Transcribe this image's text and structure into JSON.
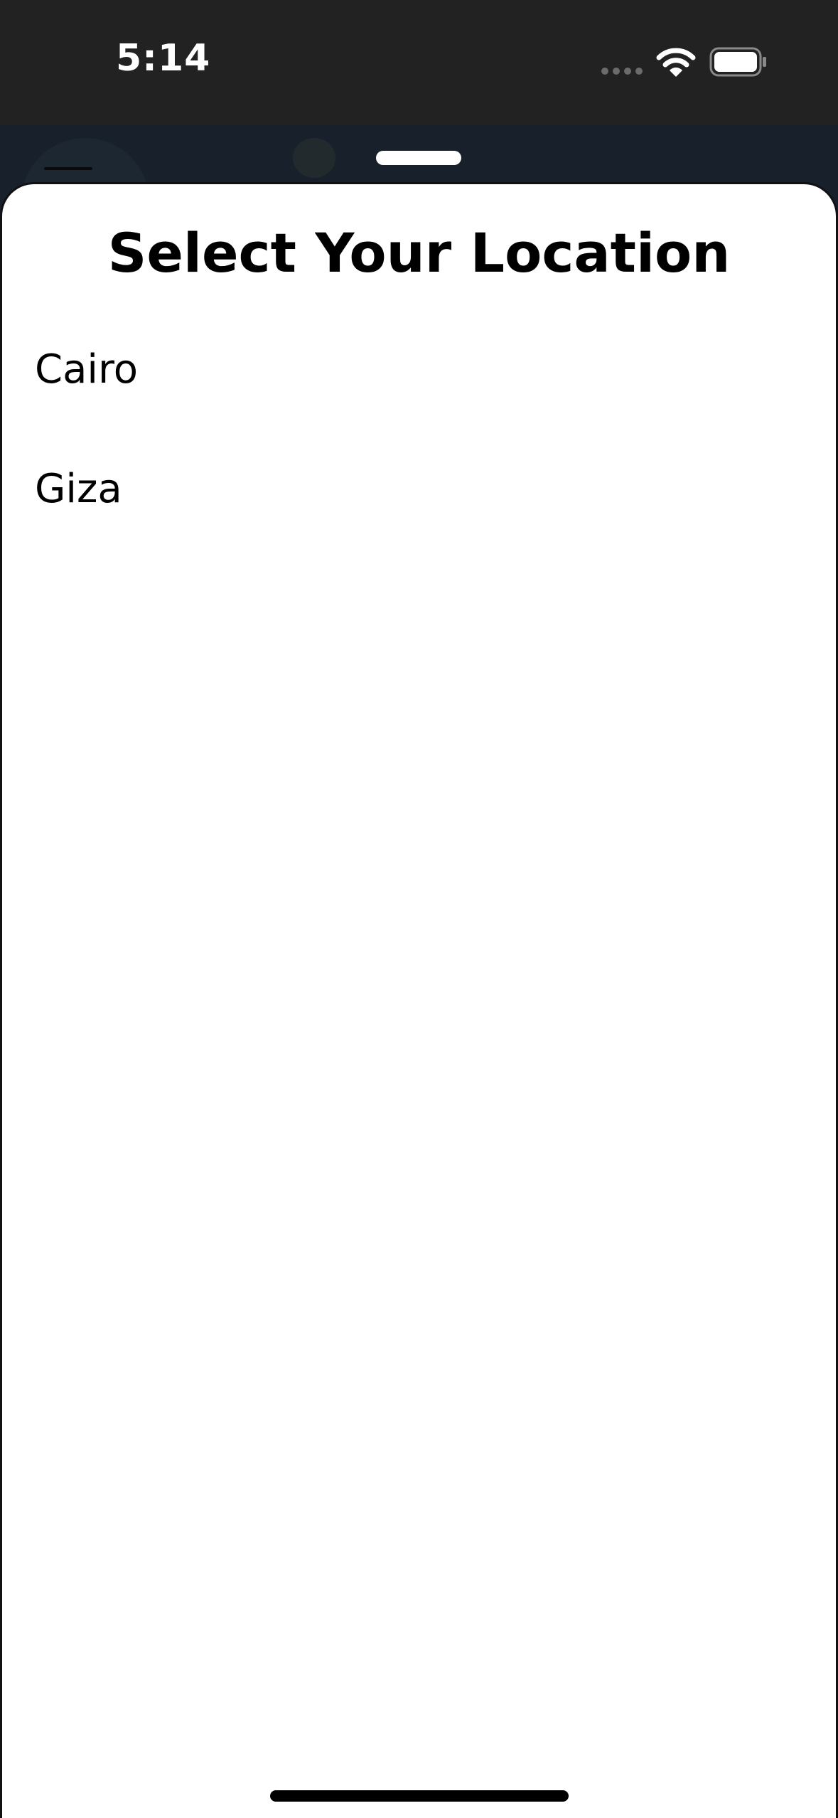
{
  "status_bar": {
    "time": "5:14",
    "icons": [
      "signal-dots-icon",
      "wifi-icon",
      "battery-icon"
    ]
  },
  "sheet": {
    "title": "Select Your Location",
    "locations": [
      {
        "label": "Cairo"
      },
      {
        "label": "Giza"
      }
    ]
  },
  "colors": {
    "status_bar_bg": "#222222",
    "backdrop_bg": "#17202b",
    "sheet_bg": "#ffffff",
    "text": "#000000"
  }
}
